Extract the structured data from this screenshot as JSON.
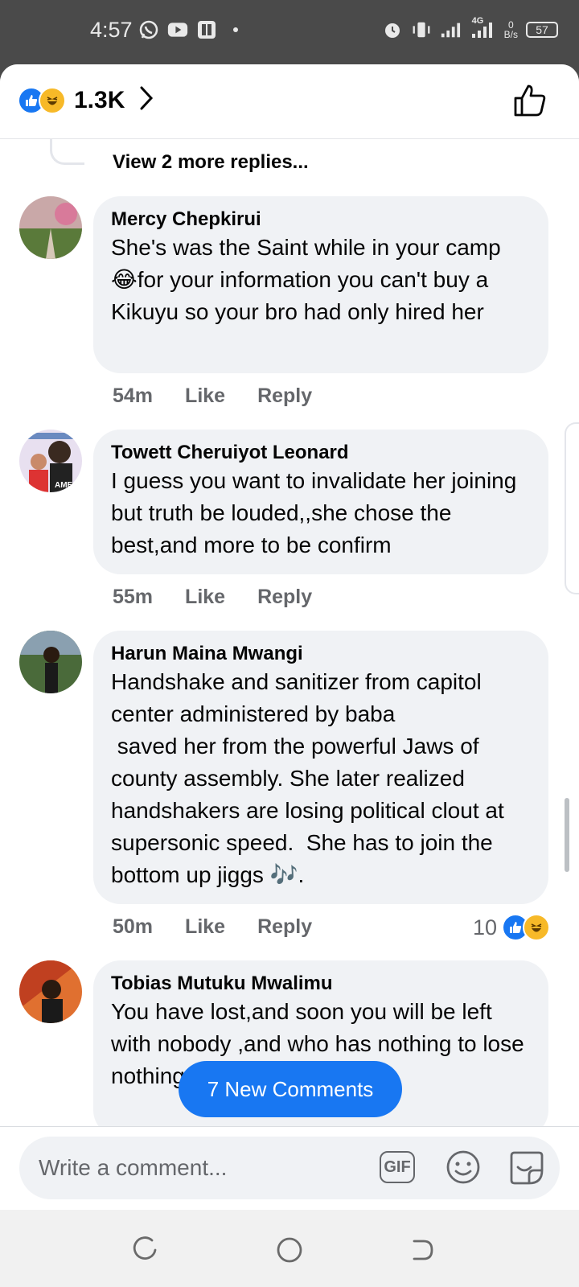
{
  "status_bar": {
    "time": "4:57",
    "network": "4G",
    "speed_value": "0",
    "speed_unit": "B/s",
    "battery": "57"
  },
  "reactions": {
    "count": "1.3K",
    "like_color": "#1877f2",
    "haha_color": "#f7b928"
  },
  "thread": {
    "view_more": "View 2 more replies..."
  },
  "comments": [
    {
      "name": "Mercy Chepkirui",
      "text": "She's was the Saint while in your camp 😂for your information you can't buy a Kikuyu so your bro had only hired her",
      "time": "54m",
      "like": "Like",
      "reply": "Reply"
    },
    {
      "name": "Towett Cheruiyot Leonard",
      "text": "I guess you want to invalidate her joining but truth be louded,,she chose the best,and more to be confirm",
      "time": "55m",
      "like": "Like",
      "reply": "Reply"
    },
    {
      "name": "Harun Maina Mwangi",
      "text": "Handshake and sanitizer from capitol center administered by baba\n saved her from the powerful Jaws of county assembly. She later realized handshakers are losing political clout at supersonic speed.  She has to join the bottom up jiggs 🎶.",
      "time": "50m",
      "like": "Like",
      "reply": "Reply",
      "reaction_count": "10"
    },
    {
      "name": "Tobias Mutuku Mwalimu",
      "text": "You have lost,and soon you will be left with nobody ,and who has nothing to lose nothing next year"
    }
  ],
  "new_comments_toast": "7 New Comments",
  "composer": {
    "placeholder": "Write a comment...",
    "gif_label": "GIF"
  }
}
